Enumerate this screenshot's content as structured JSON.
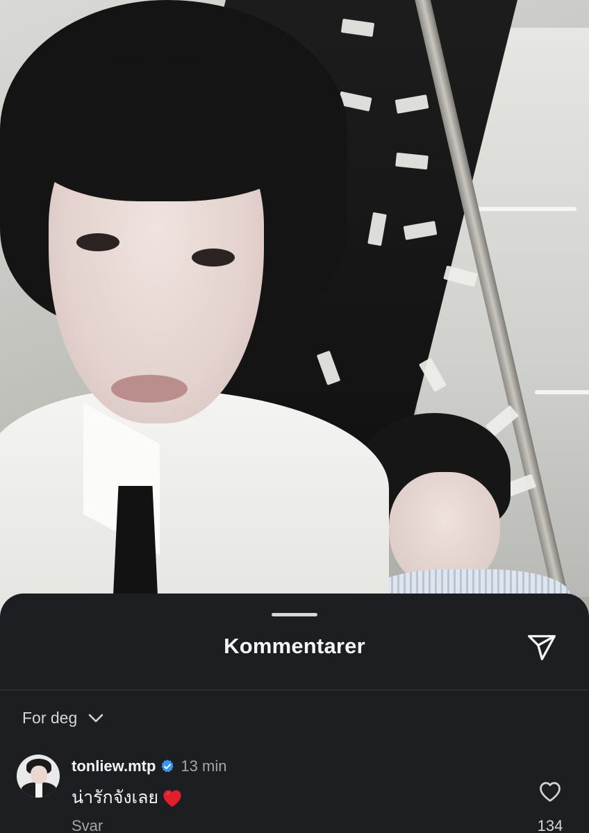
{
  "post_image": {
    "alt_icon": "photo"
  },
  "sheet": {
    "title": "Kommentarer",
    "share_icon": "send-icon",
    "sort_label": "For deg",
    "sort_icon": "chevron-down-icon"
  },
  "comments": [
    {
      "username": "tonliew.mtp",
      "verified": true,
      "timestamp": "13 min",
      "text": "น่ารักจังเลย",
      "emoji": "❤️",
      "reply_label": "Svar",
      "like_count": "134"
    }
  ],
  "colors": {
    "sheet_bg": "#1c1e22",
    "text_primary": "#f5f5f5",
    "text_secondary": "#a4a6ab",
    "verified_blue": "#3897f0",
    "heart_red": "#e0202c"
  }
}
